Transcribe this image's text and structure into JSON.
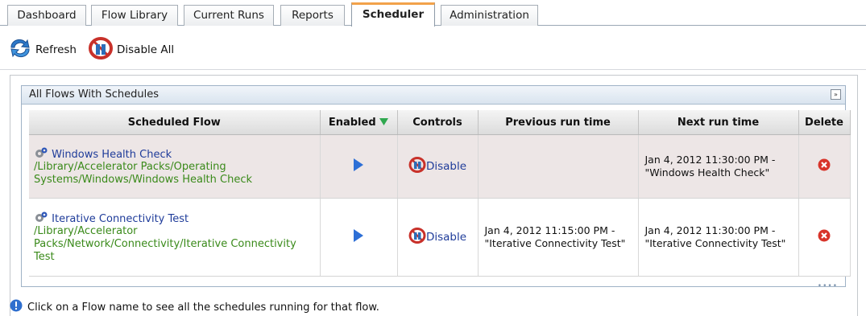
{
  "tabs": [
    {
      "label": "Dashboard",
      "active": false
    },
    {
      "label": "Flow Library",
      "active": false
    },
    {
      "label": "Current Runs",
      "active": false
    },
    {
      "label": "Reports",
      "active": false
    },
    {
      "label": "Scheduler",
      "active": true
    },
    {
      "label": "Administration",
      "active": false
    }
  ],
  "toolbar": {
    "refresh_label": "Refresh",
    "disable_all_label": "Disable All"
  },
  "panel": {
    "title": "All Flows With Schedules",
    "collapse_glyph": "»"
  },
  "table": {
    "headers": {
      "scheduled_flow": "Scheduled Flow",
      "enabled": "Enabled",
      "controls": "Controls",
      "previous_run_time": "Previous run time",
      "next_run_time": "Next run time",
      "delete": "Delete"
    },
    "rows": [
      {
        "name": "Windows Health Check",
        "path": "/Library/Accelerator Packs/Operating Systems/Windows/Windows Health Check",
        "control_label": "Disable",
        "previous_run": "",
        "next_run": "Jan 4, 2012 11:30:00 PM - \"Windows Health Check\""
      },
      {
        "name": "Iterative Connectivity Test",
        "path": "/Library/Accelerator Packs/Network/Connectivity/Iterative Connectivity Test",
        "control_label": "Disable",
        "previous_run": "Jan 4, 2012 11:15:00 PM - \"Iterative Connectivity Test\"",
        "next_run": "Jan 4, 2012 11:30:00 PM - \"Iterative Connectivity Test\""
      }
    ]
  },
  "hint": "Click on a Flow name to see all the schedules running for that flow.",
  "colors": {
    "accent_tab": "#f2a24a",
    "link_blue": "#1f3c9a",
    "path_green": "#3a8a1a",
    "sort_arrow": "#2fa84f",
    "delete_red": "#d8342a"
  },
  "icons": {
    "refresh": "refresh-icon",
    "disable_all": "disable-all-icon",
    "flow": "flow-gear-icon",
    "enabled": "play-icon",
    "disable": "disable-icon",
    "delete": "delete-icon",
    "info": "info-icon"
  }
}
